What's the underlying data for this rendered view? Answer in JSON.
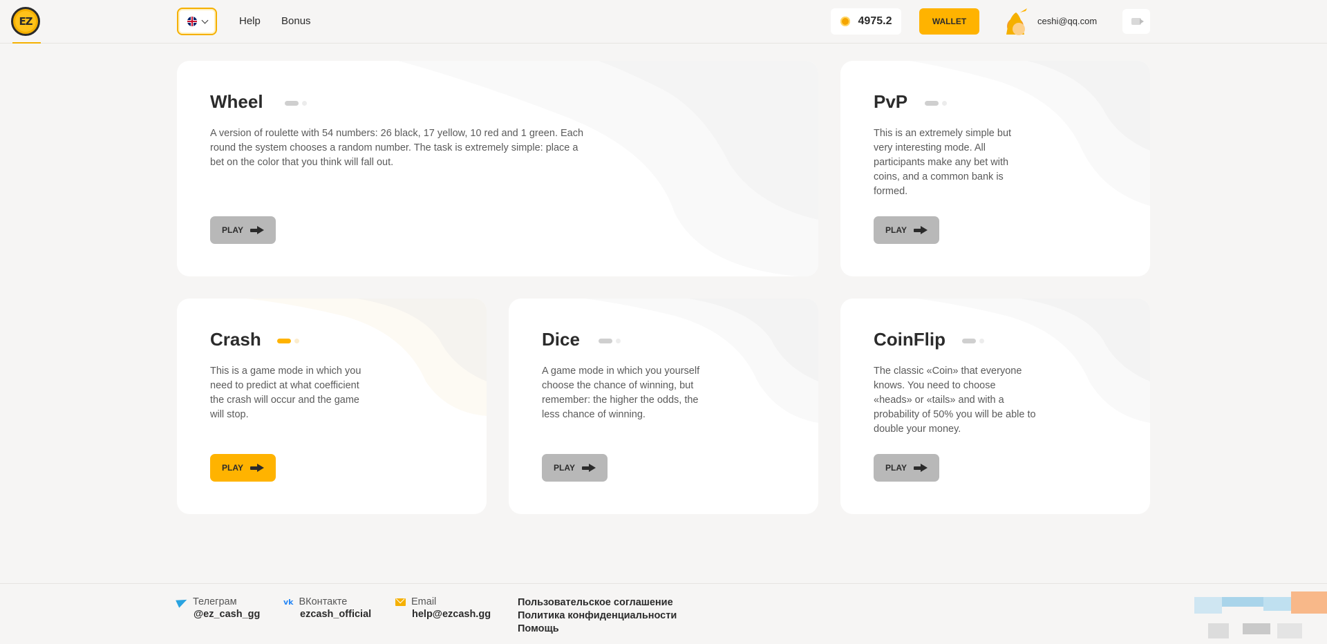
{
  "header": {
    "logo_text": "EZ",
    "language": "English",
    "nav": [
      {
        "label": "Help"
      },
      {
        "label": "Bonus"
      }
    ],
    "balance": "4975.2",
    "wallet_label": "WALLET",
    "user_email": "ceshi@qq.com"
  },
  "games": [
    {
      "id": "wheel",
      "title": "Wheel",
      "description": "A version of roulette with 54 numbers: 26 black, 17 yellow, 10 red and 1 green. Each round the system chooses a random number. The task is extremely simple: place a bet on the color that you think will fall out.",
      "play_label": "PLAY",
      "active": false
    },
    {
      "id": "pvp",
      "title": "PvP",
      "description": "This is an extremely simple but very interesting mode. All participants make any bet with coins, and a common bank is formed.",
      "play_label": "PLAY",
      "active": false
    },
    {
      "id": "crash",
      "title": "Crash",
      "description": "This is a game mode in which you need to predict at what coefficient the crash will occur and the game will stop.",
      "play_label": "PLAY",
      "active": true
    },
    {
      "id": "dice",
      "title": "Dice",
      "description": "A game mode in which you yourself choose the chance of winning, but remember: the higher the odds, the less chance of winning.",
      "play_label": "PLAY",
      "active": false
    },
    {
      "id": "coinflip",
      "title": "CoinFlip",
      "description": "The classic «Coin» that everyone knows. You need to choose «heads» or «tails» and with a probability of 50% you will be able to double your money.",
      "play_label": "PLAY",
      "active": false
    }
  ],
  "footer": {
    "telegram": {
      "label": "Телеграм",
      "value": "@ez_cash_gg"
    },
    "vk": {
      "label": "ВКонтакте",
      "value": "ezcash_official"
    },
    "email": {
      "label": "Email",
      "value": "help@ezcash.gg"
    },
    "links": [
      "Пользовательское соглашение",
      "Политика конфиденциальности",
      "Помощь"
    ]
  },
  "colors": {
    "accent": "#ffb300",
    "inactive_button": "#b8b8b8",
    "background": "#f6f5f4",
    "card": "#ffffff"
  }
}
